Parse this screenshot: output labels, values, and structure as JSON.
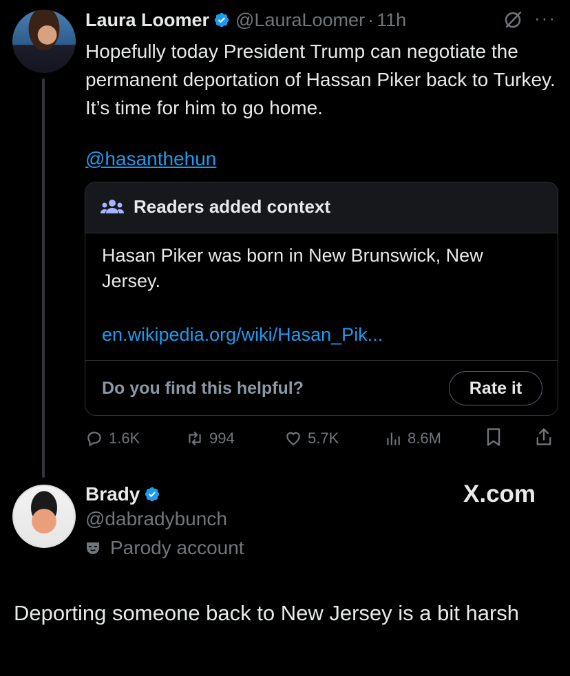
{
  "tweet": {
    "author_name": "Laura Loomer",
    "author_handle": "@LauraLoomer",
    "separator": "·",
    "time": "11h",
    "text": "Hopefully today President Trump can negotiate the permanent deportation of Hassan Piker back to Turkey. It’s time for him to go home.",
    "mention": "@hasanthehun",
    "note": {
      "title": "Readers added context",
      "body": "Hasan Piker was born in New Brunswick, New Jersey.",
      "link": "en.wikipedia.org/wiki/Hasan_Pik...",
      "question": "Do you find this helpful?",
      "rate_label": "Rate it"
    },
    "actions": {
      "replies": "1.6K",
      "reposts": "994",
      "likes": "5.7K",
      "views": "8.6M"
    }
  },
  "reply": {
    "author_name": "Brady",
    "author_handle": "@dabradybunch",
    "account_label": "Parody account",
    "text": "Deporting someone back to New Jersey is a bit harsh"
  },
  "watermark": "X.com",
  "colors": {
    "background": "#000000",
    "text": "#e7e9ea",
    "secondary": "#71767b",
    "link": "#1d9bf0",
    "verified": "#1d9bf0"
  }
}
